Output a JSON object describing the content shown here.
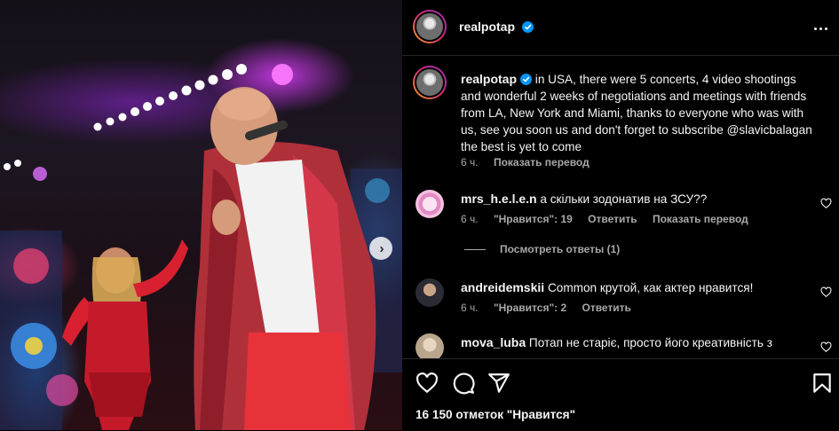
{
  "post": {
    "author": "realpotap",
    "caption": "in USA, there were 5 concerts, 4 video shootings and wonderful 2 weeks of negotiations and meetings with friends from LA, New York and Miami, thanks to everyone who was with us, see you soon us and don't forget to subscribe @slavicbalagan the best is yet to come",
    "caption_time": "6 ч.",
    "translate_label": "Показать перевод",
    "likes_text": "16 150 отметок \"Нравится\""
  },
  "comments": [
    {
      "username": "mrs_h.e.l.e.n",
      "text": "а скільки зодонатив на ЗСУ??",
      "time": "6 ч.",
      "likes": "\"Нравится\": 19",
      "reply": "Ответить",
      "translate": "Показать перевод",
      "view_replies": "Посмотреть ответы (1)"
    },
    {
      "username": "andreidemskii",
      "text": "Common крутой, как актер нравится!",
      "time": "6 ч.",
      "likes": "\"Нравится\": 2",
      "reply": "Ответить"
    },
    {
      "username": "mova_luba",
      "text": "Потап не старіє, просто його креативність з"
    }
  ],
  "icons": {
    "verified": "verified-badge-icon",
    "more": "more-options-icon",
    "like": "heart-icon",
    "comment": "comment-icon",
    "share": "share-icon",
    "save": "bookmark-icon",
    "carousel": "chevron-right-icon"
  },
  "colors": {
    "background": "#000000",
    "text": "#f5f5f5",
    "muted": "#a8a8a8",
    "verified": "#0095f6",
    "divider": "#262626"
  }
}
